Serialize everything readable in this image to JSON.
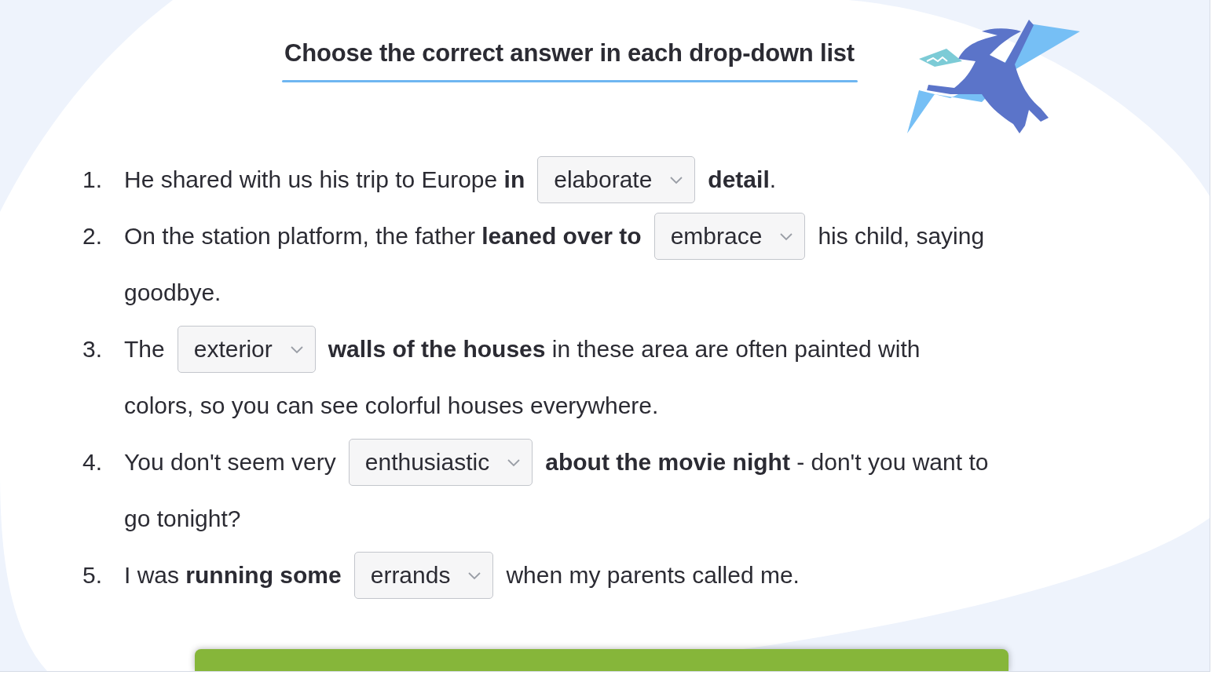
{
  "title": "Choose the correct answer in each drop-down list",
  "items": [
    {
      "number": "1.",
      "lines": [
        [
          {
            "kind": "text",
            "text": "He shared with us his trip to Europe **in**"
          },
          {
            "kind": "select",
            "value": "elaborate"
          },
          {
            "kind": "text",
            "text": "**detail**."
          }
        ]
      ]
    },
    {
      "number": "2.",
      "lines": [
        [
          {
            "kind": "text",
            "text": "On the station platform, the father **leaned over to**"
          },
          {
            "kind": "select",
            "value": "embrace"
          },
          {
            "kind": "text",
            "text": "his child, saying"
          }
        ],
        [
          {
            "kind": "text",
            "text": "goodbye."
          }
        ]
      ]
    },
    {
      "number": "3.",
      "lines": [
        [
          {
            "kind": "text",
            "text": "The"
          },
          {
            "kind": "select",
            "value": "exterior"
          },
          {
            "kind": "text",
            "text": "**walls of the houses** in these area are often painted with"
          }
        ],
        [
          {
            "kind": "text",
            "text": "colors, so you can see colorful houses everywhere."
          }
        ]
      ]
    },
    {
      "number": "4.",
      "lines": [
        [
          {
            "kind": "text",
            "text": "You don't seem very"
          },
          {
            "kind": "select",
            "value": "enthusiastic"
          },
          {
            "kind": "text",
            "text": "**about the movie night** - don't you want to"
          }
        ],
        [
          {
            "kind": "text",
            "text": "go tonight?"
          }
        ]
      ]
    },
    {
      "number": "5.",
      "lines": [
        [
          {
            "kind": "text",
            "text": "I was **running some**"
          },
          {
            "kind": "select",
            "value": "errands"
          },
          {
            "kind": "text",
            "text": "when my parents called me."
          }
        ]
      ]
    }
  ]
}
